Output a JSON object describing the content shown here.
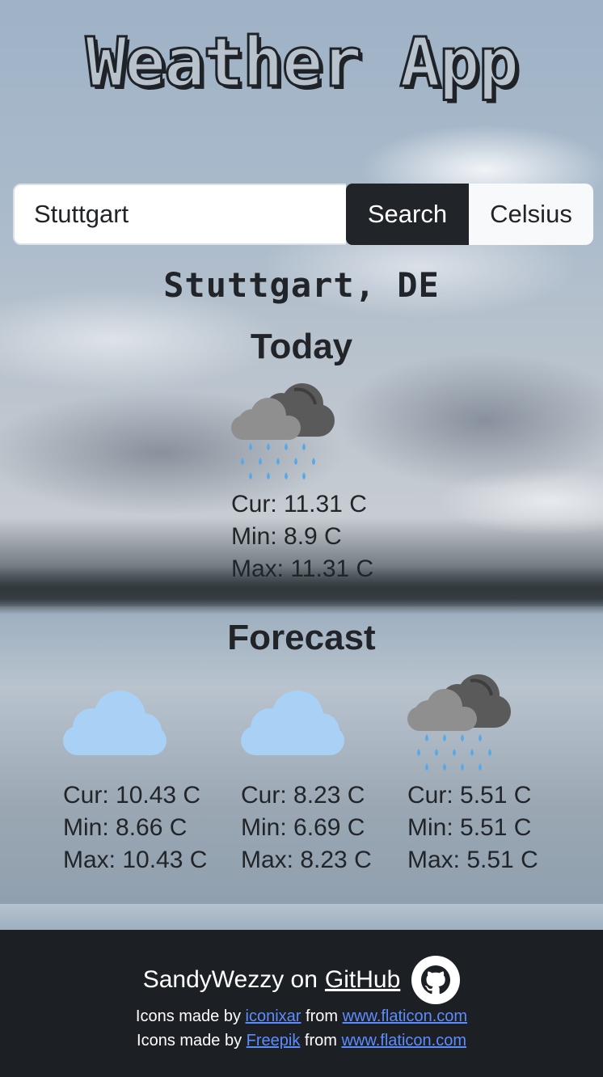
{
  "app": {
    "title": "Weather App"
  },
  "search": {
    "value": "Stuttgart",
    "button": "Search",
    "unit_toggle": "Celsius"
  },
  "location": {
    "label": "Stuttgart, DE"
  },
  "today": {
    "heading": "Today",
    "icon": "rain-cloud-icon",
    "cur": "Cur: 11.31 C",
    "min": "Min: 8.9 C",
    "max": "Max: 11.31 C"
  },
  "forecast": {
    "heading": "Forecast",
    "days": [
      {
        "icon": "cloud-icon",
        "cur": "Cur: 10.43 C",
        "min": "Min: 8.66 C",
        "max": "Max: 10.43 C"
      },
      {
        "icon": "cloud-icon",
        "cur": "Cur: 8.23 C",
        "min": "Min: 6.69 C",
        "max": "Max: 8.23 C"
      },
      {
        "icon": "rain-cloud-icon",
        "cur": "Cur: 5.51 C",
        "min": "Min: 5.51 C",
        "max": "Max: 5.51 C"
      }
    ]
  },
  "footer": {
    "author": "SandyWezzy on",
    "github_link": "GitHub ",
    "credit_prefix": "Icons made by",
    "credit_from": "from",
    "credit1_author": "iconixar",
    "credit2_author": "Freepik",
    "credit_site": "www.flaticon.com"
  },
  "colors": {
    "dark": "#212529",
    "footer_bg": "#1c1f23",
    "link": "#5b8dff",
    "cloud_light": "#a9d0f5",
    "cloud_grey": "#8f8f8f",
    "cloud_dark": "#5a5a5a",
    "rain": "#5aa9e6"
  }
}
